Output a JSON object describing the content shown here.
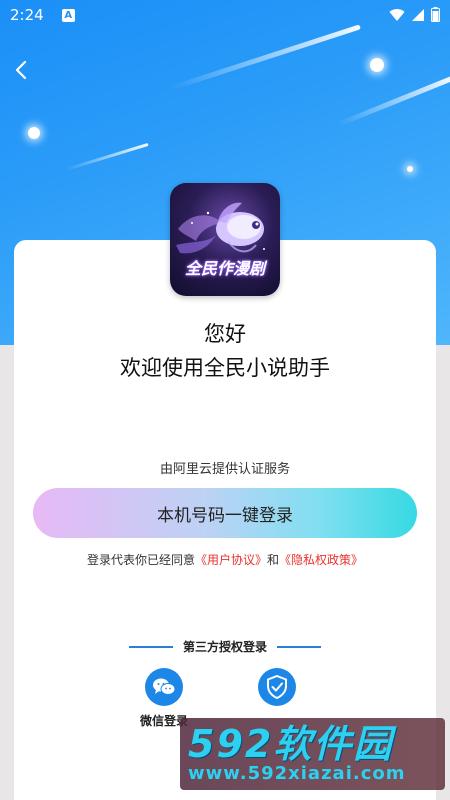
{
  "status_bar": {
    "time": "2:24",
    "notification_letter": "A"
  },
  "header": {
    "back_icon": "chevron-left-icon"
  },
  "logo": {
    "app_name": "全民作漫剧"
  },
  "greeting": {
    "hello": "您好",
    "welcome": "欢迎使用全民小说助手"
  },
  "auth": {
    "provider": "由阿里云提供认证服务",
    "login_button": "本机号码一键登录",
    "agreement_prefix": "登录代表你已经同意",
    "user_agreement": "《用户协议》",
    "and": "和",
    "privacy_policy": "《隐私权政策》"
  },
  "third_party": {
    "title": "第三方授权登录",
    "options": [
      {
        "label": "微信登录",
        "icon": "wechat-icon"
      },
      {
        "label": "",
        "icon": "shield-icon"
      }
    ]
  },
  "watermark": {
    "brand": "592软件园",
    "url": "www.592xiazai.com"
  },
  "colors": {
    "primary_blue": "#1d87e8",
    "link_red": "#e8322e",
    "hero_blue": "#2b9cf8"
  }
}
